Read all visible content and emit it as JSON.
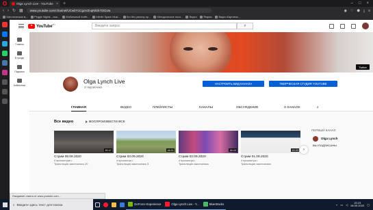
{
  "browser": {
    "tab_title": "Olga Lynch Live - YouTube",
    "url": "www.youtube.com/channel/UCwbY1CgoVZnqNlGk7GtDJw",
    "bookmarks": [
      "Католическая м...",
      "Peggie Nights - сма...",
      "Мобильный Inoffe...",
      "Infinite Space Musi...",
      "Кот без умничу ар...",
      "Методическое посо...",
      "Видео",
      "Яндекс",
      "Видео.Картинок..."
    ],
    "status_text": "Ожидание ответа от www.youtube.com..."
  },
  "youtube": {
    "logo_text": "YouTube",
    "logo_region": "RU",
    "search_placeholder": "Введите запрос",
    "left_nav": [
      {
        "label": "Главная",
        "icon": "home-icon"
      },
      {
        "label": "В тренде",
        "icon": "trending-icon"
      },
      {
        "label": "Подписки",
        "icon": "subscriptions-icon"
      },
      {
        "label": "Библиотека",
        "icon": "library-icon"
      }
    ],
    "banner_badge": "Twitter",
    "channel": {
      "name": "Olga Lynch Live",
      "subscribers": "3 подписчика",
      "btn_setup": "НАСТРОИТЬ ВИД КАНАЛА",
      "btn_studio": "ТВОРЧЕСКАЯ СТУДИЯ YOUTUBE"
    },
    "tabs": [
      "ГЛАВНАЯ",
      "ВИДЕО",
      "ПЛЕЙЛИСТЫ",
      "КАНАЛЫ",
      "ОБСУЖДЕНИЕ",
      "О КАНАЛЕ"
    ],
    "active_tab": "ГЛАВНАЯ",
    "section_title": "Все видео",
    "play_all": "ВОСПРОИЗВЕСТИ ВСЕ",
    "videos": [
      {
        "title": "Стрим 08.09.2020",
        "views": "6 просмотров •",
        "meta": "Трансляция закончилась 20",
        "duration": "50:47"
      },
      {
        "title": "Стрим 03.09.2020",
        "views": "4 просмотра •",
        "meta": "Трансляция закончилась 5",
        "duration": "46:01"
      },
      {
        "title": "Стрим 02.09.2020",
        "views": "4 просмотра •",
        "meta": "Трансляция закончилась",
        "duration": "46:43"
      },
      {
        "title": "Стрим 01.09.2020",
        "views": "4 просмотра •",
        "meta": "Трансляция закончилась",
        "duration": "40:33"
      }
    ],
    "featured": {
      "title": "ПЕРВЫЙ КАНАЛ",
      "channel_name": "Olga Lynch",
      "subscribed_label": "ВЫ ПОДПИСАНЫ"
    }
  },
  "taskbar": {
    "search_placeholder": "Введите здесь текст для поиска",
    "apps": [
      "GeForce Experience",
      "Olga Lynch Live - Y...",
      "BlueStacks"
    ],
    "time": "15:19",
    "date": "08.09.2020"
  },
  "colors": {
    "youtube_red": "#ff0000",
    "button_blue": "#065fd4",
    "opera_red": "#ff1b2d"
  }
}
